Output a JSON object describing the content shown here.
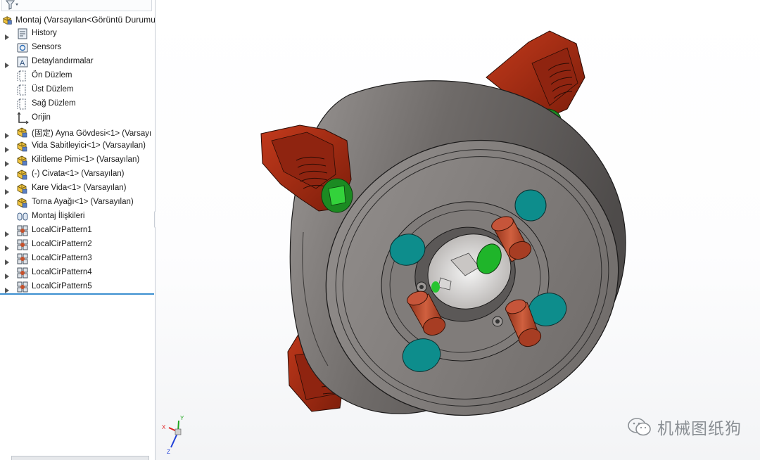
{
  "tree": {
    "root": {
      "label": "Montaj  (Varsayılan<Görüntü Durumu"
    },
    "items": [
      {
        "label": "History",
        "icon": "history-icon",
        "expandable": true
      },
      {
        "label": "Sensors",
        "icon": "sensor-icon",
        "expandable": false
      },
      {
        "label": "Detaylandırmalar",
        "icon": "annotation-icon",
        "expandable": true
      },
      {
        "label": "Ön Düzlem",
        "icon": "plane-icon",
        "expandable": false
      },
      {
        "label": "Üst Düzlem",
        "icon": "plane-icon",
        "expandable": false
      },
      {
        "label": "Sağ Düzlem",
        "icon": "plane-icon",
        "expandable": false
      },
      {
        "label": "Orijin",
        "icon": "origin-icon",
        "expandable": false
      },
      {
        "label": "(固定) Ayna Gövdesi<1> (Varsayı",
        "icon": "part-icon",
        "expandable": true
      },
      {
        "label": "Vida Sabitleyici<1> (Varsayılan)",
        "icon": "part-icon",
        "expandable": true
      },
      {
        "label": "Kilitleme Pimi<1> (Varsayılan)",
        "icon": "part-icon",
        "expandable": true
      },
      {
        "label": "(-) Civata<1> (Varsayılan)",
        "icon": "part-icon",
        "expandable": true
      },
      {
        "label": "Kare Vida<1> (Varsayılan)",
        "icon": "part-icon",
        "expandable": true
      },
      {
        "label": "Torna Ayağı<1> (Varsayılan)",
        "icon": "part-icon",
        "expandable": true
      },
      {
        "label": "Montaj İlişkileri",
        "icon": "mates-icon",
        "expandable": false
      },
      {
        "label": "LocalCirPattern1",
        "icon": "pattern-icon",
        "expandable": true
      },
      {
        "label": "LocalCirPattern2",
        "icon": "pattern-icon",
        "expandable": true
      },
      {
        "label": "LocalCirPattern3",
        "icon": "pattern-icon",
        "expandable": true
      },
      {
        "label": "LocalCirPattern4",
        "icon": "pattern-icon",
        "expandable": true
      },
      {
        "label": "LocalCirPattern5",
        "icon": "pattern-icon",
        "expandable": true
      }
    ]
  },
  "triad": {
    "x": "X",
    "y": "Y",
    "z": "Z"
  },
  "watermark": {
    "text": "机械图纸狗"
  },
  "colors": {
    "chuck_body": "#7b7775",
    "chuck_face": "#8a8684",
    "jaw": "#a62b12",
    "pin": "#b3462b",
    "teal_hole": "#0d8d8c",
    "green_socket": "#27c430",
    "selection_blue": "#3c8fd0"
  }
}
